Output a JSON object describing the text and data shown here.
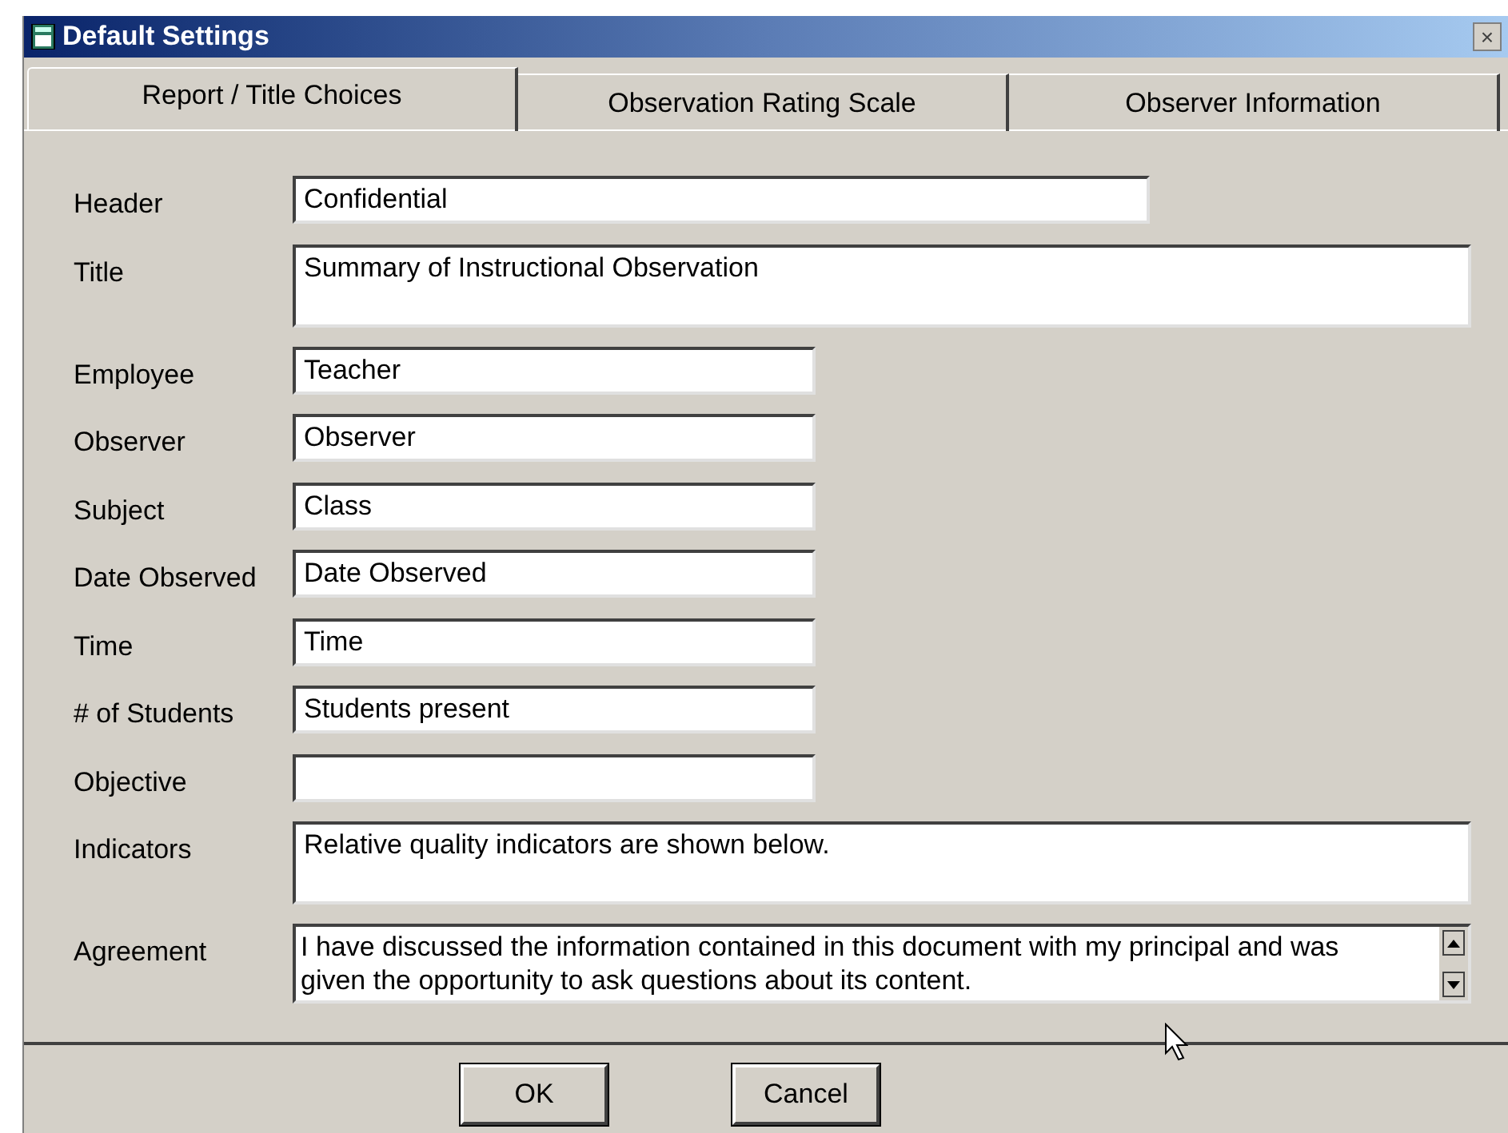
{
  "window": {
    "title": "Default Settings",
    "close": "×"
  },
  "tabs": [
    {
      "label": "Report / Title Choices",
      "selected": true
    },
    {
      "label": "Observation Rating Scale",
      "selected": false
    },
    {
      "label": "Observer Information",
      "selected": false
    }
  ],
  "fields": [
    {
      "label": "Header",
      "value": "Confidential",
      "kind": "long"
    },
    {
      "label": "Title",
      "value": "Summary of Instructional Observation",
      "kind": "area"
    },
    {
      "label": "Employee",
      "value": "Teacher",
      "kind": "short"
    },
    {
      "label": "Observer",
      "value": "Observer",
      "kind": "short"
    },
    {
      "label": "Subject",
      "value": "Class",
      "kind": "short"
    },
    {
      "label": "Date Observed",
      "value": "Date Observed",
      "kind": "short"
    },
    {
      "label": "Time",
      "value": "Time",
      "kind": "short"
    },
    {
      "label": "# of Students",
      "value": "Students present",
      "kind": "short"
    },
    {
      "label": "Objective",
      "kind": "short"
    },
    {
      "label": "Indicators",
      "value": "Relative quality indicators are shown below.",
      "kind": "area"
    },
    {
      "label": "Agreement",
      "value": "I have discussed the information contained in this document with my principal and was given the opportunity to ask questions about its content.",
      "kind": "scroll"
    }
  ],
  "buttons": [
    "OK",
    "Cancel"
  ]
}
